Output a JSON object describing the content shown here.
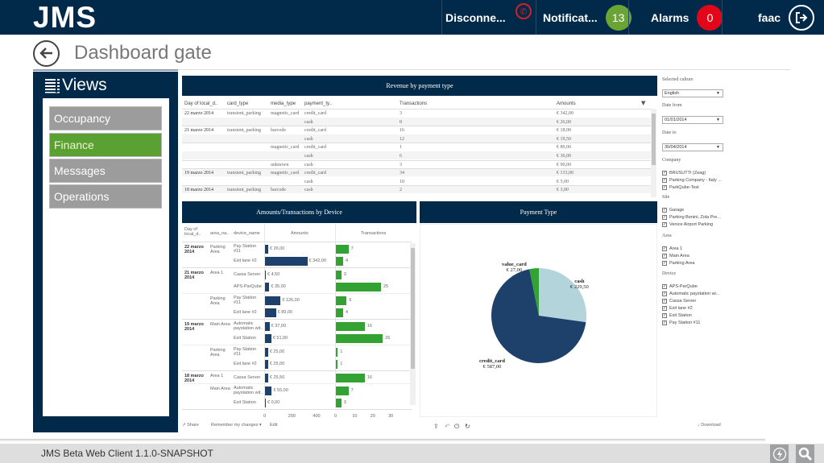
{
  "app": {
    "logo": "JMS",
    "status_text": "JMS Beta Web Client 1.1.0-SNAPSHOT"
  },
  "topbar": {
    "connection_label": "Disconne...",
    "notifications_label": "Notificat...",
    "notifications_count": "13",
    "alarms_label": "Alarms",
    "alarms_count": "0",
    "user": "faac",
    "colors": {
      "bar": "#012a4a",
      "notif_badge": "#6aa434",
      "alarm_badge": "#e3061b",
      "phone": "#d1202a"
    }
  },
  "page": {
    "title": "Dashboard gate"
  },
  "views": {
    "title": "Views",
    "items": [
      {
        "label": "Occupancy",
        "active": false
      },
      {
        "label": "Finance",
        "active": true
      },
      {
        "label": "Messages",
        "active": false
      },
      {
        "label": "Operations",
        "active": false
      }
    ]
  },
  "revenue": {
    "title": "Revenue by payment type",
    "columns": [
      "Day of local_d..",
      "card_type",
      "media_type",
      "payment_ty..",
      "Transactions",
      "Amounts"
    ],
    "rows": [
      [
        "22 marzo 2014",
        "transient_parking",
        "magnetic_card",
        "credit_card",
        "3",
        "€ 342,00"
      ],
      [
        "",
        "",
        "",
        "cash",
        "8",
        "€ 26,00"
      ],
      [
        "21 marzo 2014",
        "transient_parking",
        "barcode",
        "credit_card",
        "16",
        "€ 18,00"
      ],
      [
        "",
        "",
        "",
        "cash",
        "12",
        "€ 19,50"
      ],
      [
        "",
        "",
        "magnetic_card",
        "credit_card",
        "1",
        "€ 89,00"
      ],
      [
        "",
        "",
        "",
        "cash",
        "6",
        "€ 36,00"
      ],
      [
        "",
        "",
        "unknown",
        "cash",
        "3",
        "€ 90,00"
      ],
      [
        "19 marzo 2014",
        "transient_parking",
        "magnetic_card",
        "credit_card",
        "34",
        "€ 133,00"
      ],
      [
        "",
        "",
        "",
        "cash",
        "10",
        "€ 5,00"
      ],
      [
        "18 marzo 2014",
        "transient_parking",
        "barcode",
        "cash",
        "2",
        "€ 3,00"
      ]
    ]
  },
  "device": {
    "title": "Amounts/Transactions by Device",
    "columns": [
      "Day of local_d..",
      "area_na..",
      "device_name",
      "Amounts",
      "Transactions"
    ],
    "amount_ticks": [
      "0",
      "200",
      "400"
    ],
    "transaction_ticks": [
      "0",
      "10",
      "20",
      "30"
    ],
    "amount_max": 560,
    "transaction_max": 38,
    "rows": [
      {
        "day": "22 marzo 2014",
        "area": "Parking Area",
        "device": "Pay Station #11",
        "amount": 26.0,
        "amount_label": "€ 26,00",
        "transactions": 7,
        "tx_label": "7"
      },
      {
        "day": "",
        "area": "",
        "device": "Exit lane #2",
        "amount": 342.0,
        "amount_label": "€ 342,00",
        "transactions": 4,
        "tx_label": "4"
      },
      {
        "day": "21 marzo 2014",
        "area": "Area 1",
        "device": "Cassa Server",
        "amount": 4.5,
        "amount_label": "€ 4,50",
        "transactions": 3,
        "tx_label": "3"
      },
      {
        "day": "",
        "area": "",
        "device": "APS-ParQube",
        "amount": 35.0,
        "amount_label": "€ 35,00",
        "transactions": 25,
        "tx_label": "25"
      },
      {
        "day": "",
        "area": "Parking Area",
        "device": "Pay Station #11",
        "amount": 126.0,
        "amount_label": "€ 126,00",
        "transactions": 6,
        "tx_label": "6"
      },
      {
        "day": "",
        "area": "",
        "device": "Exit lane #2",
        "amount": 89.0,
        "amount_label": "€ 89,00",
        "transactions": 4,
        "tx_label": "4"
      },
      {
        "day": "19 marzo 2014",
        "area": "Main Area",
        "device": "Automatic paystation wit..",
        "amount": 37.0,
        "amount_label": "€ 37,00",
        "transactions": 16,
        "tx_label": "16"
      },
      {
        "day": "",
        "area": "",
        "device": "Exit Station",
        "amount": 51.0,
        "amount_label": "€ 51,00",
        "transactions": 26,
        "tx_label": "26"
      },
      {
        "day": "",
        "area": "Parking Area",
        "device": "Pay Station #11",
        "amount": 25.0,
        "amount_label": "€ 25,00",
        "transactions": 1,
        "tx_label": "1"
      },
      {
        "day": "",
        "area": "",
        "device": "Exit lane #2",
        "amount": 25.0,
        "amount_label": "€ 25,00",
        "transactions": 1,
        "tx_label": "1"
      },
      {
        "day": "18 marzo 2014",
        "area": "Area 1",
        "device": "Cassa Server",
        "amount": 25.5,
        "amount_label": "€ 25,50",
        "transactions": 16,
        "tx_label": "16"
      },
      {
        "day": "",
        "area": "Main Area",
        "device": "Automatic paystation wit..",
        "amount": 55.0,
        "amount_label": "€ 55,00",
        "transactions": 7,
        "tx_label": "7"
      },
      {
        "day": "",
        "area": "",
        "device": "Exit Station",
        "amount": 0.0,
        "amount_label": "€ 0,00",
        "transactions": 3,
        "tx_label": "3"
      }
    ],
    "colors": {
      "amount": "#1e416b",
      "transactions": "#32a332"
    }
  },
  "chart_data": {
    "type": "pie",
    "title": "Payment Type",
    "slices": [
      {
        "label": "cash",
        "value": 229.5,
        "value_label": "€ 229,50",
        "color": "#b4d4dc"
      },
      {
        "label": "credit_card",
        "value": 587.0,
        "value_label": "€ 587,00",
        "color": "#1e416b"
      },
      {
        "label": "value_card",
        "value": 27.0,
        "value_label": "€ 27,00",
        "color": "#32a332"
      }
    ]
  },
  "filters": {
    "culture_label": "Selected culture",
    "culture_value": "English",
    "date_from_label": "Date from",
    "date_from_value": "01/01/2014",
    "date_to_label": "Date to",
    "date_to_value": "30/04/2014",
    "company_label": "Company",
    "companies": [
      "BRUSUTTI (Zeag)",
      "Parking Company - Italy ...",
      "ParkQube-Test"
    ],
    "site_label": "Site",
    "sites": [
      "Garage",
      "Parking Benini, Zola Pre...",
      "Venice Airport Parking"
    ],
    "area_label": "Area",
    "areas": [
      "Area 1",
      "Main Area",
      "Parking Area"
    ],
    "device_label": "Device",
    "devices": [
      "APS-ParQube",
      "Automatic paystation wi...",
      "Cassa Server",
      "Exit lane #2",
      "Exit Station",
      "Pay Station #11"
    ]
  },
  "toolbar": {
    "share": "Share",
    "remember": "Remember my changes ▾",
    "edit": "Edit",
    "download": "Download"
  }
}
